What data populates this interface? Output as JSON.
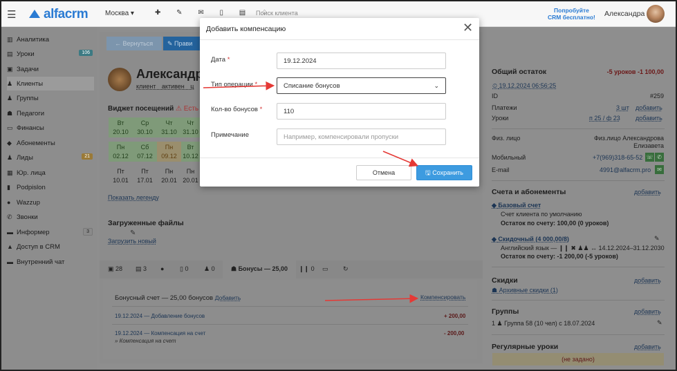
{
  "topbar": {
    "logo": "alfacrm",
    "branch": "Москва ▾",
    "search_placeholder": "Поиск клиента",
    "promo_line1": "Попробуйте",
    "promo_line2": "CRM бесплатно!",
    "user": "Александра"
  },
  "sidebar": {
    "items": [
      {
        "icon": "chart-icon",
        "glyph": "▥",
        "label": "Аналитика"
      },
      {
        "icon": "book-icon",
        "glyph": "▤",
        "label": "Уроки",
        "badge": "106"
      },
      {
        "icon": "task-icon",
        "glyph": "▣",
        "label": "Задачи"
      },
      {
        "icon": "user-icon",
        "glyph": "♟",
        "label": "Клиенты"
      },
      {
        "icon": "users-icon",
        "glyph": "♟",
        "label": "Группы"
      },
      {
        "icon": "teacher-icon",
        "glyph": "☗",
        "label": "Педагоги"
      },
      {
        "icon": "finance-icon",
        "glyph": "▭",
        "label": "Финансы"
      },
      {
        "icon": "tag-icon",
        "glyph": "◆",
        "label": "Абонементы"
      },
      {
        "icon": "leads-icon",
        "glyph": "♟",
        "label": "Лиды",
        "badge": "21"
      },
      {
        "icon": "building-icon",
        "glyph": "▦",
        "label": "Юр. лица"
      },
      {
        "icon": "file-icon",
        "glyph": "▮",
        "label": "Podpislon"
      },
      {
        "icon": "whatsapp-icon",
        "glyph": "●",
        "label": "Wazzup"
      },
      {
        "icon": "phone-icon",
        "glyph": "✆",
        "label": "Звонки"
      },
      {
        "icon": "informer-icon",
        "glyph": "▬",
        "label": "Информер",
        "badge": "3"
      },
      {
        "icon": "lock-icon",
        "glyph": "▲",
        "label": "Доступ в CRM"
      },
      {
        "icon": "chat-icon",
        "glyph": "▬",
        "label": "Внутренний чат"
      }
    ]
  },
  "page": {
    "back_button": "← Вернуться",
    "edit_button": "✎ Прави",
    "client_name": "Александр",
    "client_tags": "клиент активен ц",
    "widget_title": "Виджет посещений",
    "widget_warn": "⚠ Есть с",
    "visits_row1": [
      {
        "day": "Вт",
        "date": "20.10"
      },
      {
        "day": "Ср",
        "date": "30.10"
      },
      {
        "day": "Чт",
        "date": "31.10"
      },
      {
        "day": "Чт",
        "date": "31.10"
      }
    ],
    "visits_row2": [
      {
        "day": "Пн",
        "date": "02.12"
      },
      {
        "day": "Сб",
        "date": "07.12"
      },
      {
        "day": "Пн",
        "date": "09.12"
      },
      {
        "day": "Вт",
        "date": "10.12"
      }
    ],
    "visits_row3": [
      {
        "day": "Пт",
        "date": "10.01"
      },
      {
        "day": "Пт",
        "date": "17.01"
      },
      {
        "day": "Пн",
        "date": "20.01"
      },
      {
        "day": "Пн",
        "date": "20.01"
      }
    ],
    "legend_link": "Показать легенду",
    "files_title": "Загруженные файлы",
    "upload_link": "Загрузить новый",
    "tabs": [
      "▣ 28",
      "▤ 3",
      "●",
      "▯ 0",
      "♟ 0",
      "☗ Бонусы — 25,00",
      "❙❙ 0",
      "▭",
      "↻"
    ],
    "bonus_line": "Бонусный счет — 25,00 бонусов",
    "bonus_add": "Добавить",
    "compensate_link": "Компенсировать",
    "transactions": [
      {
        "text": "19.12.2024 — Добавление бонусов",
        "amount": "+ 200,00",
        "sub": ""
      },
      {
        "text": "19.12.2024 — Компенсация на счет",
        "amount": "- 200,00",
        "sub": "» Компенсация на счет"
      }
    ]
  },
  "right": {
    "total_title": "Общий остаток",
    "total_value": "-5 уроков  -1 100,00",
    "date_link": "19.12.2024 06:56:25",
    "id_label": "ID",
    "id_value": "#259",
    "payments_label": "Платежи",
    "payments_value": "3 шт",
    "payments_add": "добавить",
    "lessons_label": "Уроки",
    "lessons_value": "п 25 / ф 23",
    "lessons_add": "добавить",
    "person_label": "Физ. лицо",
    "person_value1": "Физ.лицо Александрова",
    "person_value2": "Елизавета",
    "mobile_label": "Мобильный",
    "mobile_value": "+7(969)318-65-52",
    "email_label": "E-mail",
    "email_value": "4991@alfacrm.pro",
    "accounts_title": "Счета и абонементы",
    "accounts_add": "добавить",
    "base_account": "Базовый счет",
    "base_sub": "Счет клиента по умолчанию",
    "base_balance": "Остаток по счету: 100,00 (0 уроков)",
    "discount_account": "Скидочный (4 000,00/8)",
    "discount_sub": "Английский язык — ❙❙ ✖ ♟♟ ↔ 14.12.2024–31.12.2030",
    "discount_balance": "Остаток по счету: -1 200,00 (-5 уроков)",
    "discounts_title": "Скидки",
    "discounts_add": "добавить",
    "discounts_archive": "Архивные скидки (1)",
    "groups_title": "Группы",
    "groups_add": "добавить",
    "group_item": "1 ♟ Группа 58 (10 чел) с 18.07.2024",
    "regular_title": "Регулярные уроки",
    "regular_add": "добавить",
    "not_set": "(не задано)"
  },
  "modal": {
    "title": "Добавить компенсацию",
    "date_label": "Дата",
    "date_value": "19.12.2024",
    "type_label": "Тип операции",
    "type_value": "Списание бонусов",
    "count_label": "Кол-во бонусов",
    "count_value": "110",
    "note_label": "Примечание",
    "note_placeholder": "Например, компенсировали пропуски",
    "cancel": "Отмена",
    "save": "Сохранить",
    "required_mark": "*"
  },
  "colors": {
    "accent": "#3d9be0",
    "brand": "#2a7bd3",
    "arrow": "#e53935",
    "required": "#d43333"
  }
}
